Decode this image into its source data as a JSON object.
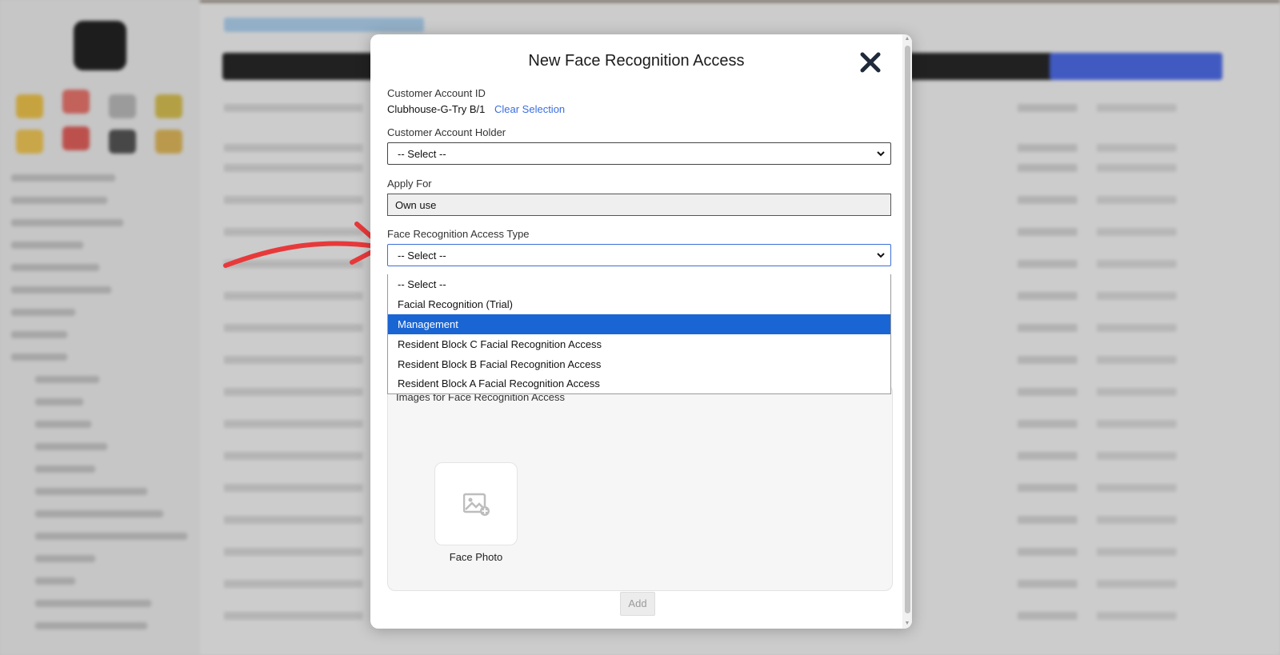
{
  "modal": {
    "title": "New Face Recognition Access",
    "customer_account_id": {
      "label": "Customer Account ID",
      "value": "Clubhouse-G-Try B/1",
      "clear_label": "Clear Selection"
    },
    "customer_account_holder": {
      "label": "Customer Account Holder",
      "selected": "-- Select --"
    },
    "apply_for": {
      "label": "Apply For",
      "value": "Own use"
    },
    "access_type": {
      "label": "Face Recognition Access Type",
      "selected": "-- Select --",
      "options": [
        "-- Select --",
        "Facial Recognition (Trial)",
        "Management",
        "Resident Block C Facial Recognition Access",
        "Resident Block B Facial Recognition Access",
        "Resident Block A Facial Recognition Access"
      ],
      "highlighted_option": "Management"
    },
    "images": {
      "label": "Images for Face Recognition Access",
      "photo_caption": "Face Photo"
    },
    "add_label": "Add"
  },
  "colors": {
    "highlight": "#1a65d4",
    "link": "#3a6ee0",
    "annotation_arrow": "#e8393a"
  },
  "icons": [
    "close-icon",
    "chevron-down-icon",
    "image-add-icon",
    "annotation-arrow"
  ]
}
